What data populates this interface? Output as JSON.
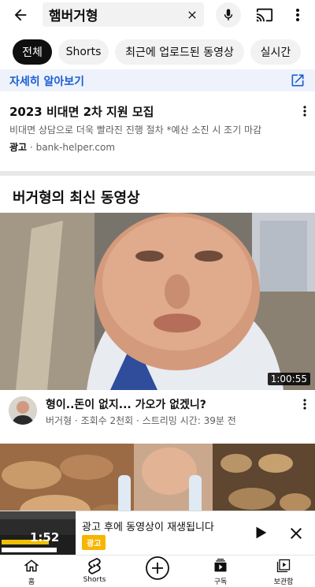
{
  "search": {
    "query": "햄버거형"
  },
  "chips": [
    "전체",
    "Shorts",
    "최근에 업로드된 동영상",
    "실시간"
  ],
  "learn_more": {
    "label": "자세히 알아보기"
  },
  "ad": {
    "title": "2023 비대면 2차 지원 모집",
    "description": "비대면 상담으로 더욱 빨라진 진행 절차 *예산 소진 시 조기 마감",
    "badge": "광고",
    "separator": "·",
    "domain": "bank-helper.com"
  },
  "section": {
    "title": "버거형의 최신 동영상"
  },
  "video": {
    "title": "형이..돈이 없지... 가오가 없겠니?",
    "meta": "버거형 · 조회수 2천회 · 스트리밍 시간: 39분 전",
    "duration": "1:00:55"
  },
  "overlay": {
    "text": "광고 후에 동영상이 재생됩니다",
    "badge": "광고",
    "mini_time": "1:52"
  },
  "nav": {
    "home": "홈",
    "shorts": "Shorts",
    "subscriptions": "구독",
    "library": "보관함"
  },
  "colors": {
    "accent_blue": "#1a5dd6",
    "ad_badge": "#f7b500"
  }
}
